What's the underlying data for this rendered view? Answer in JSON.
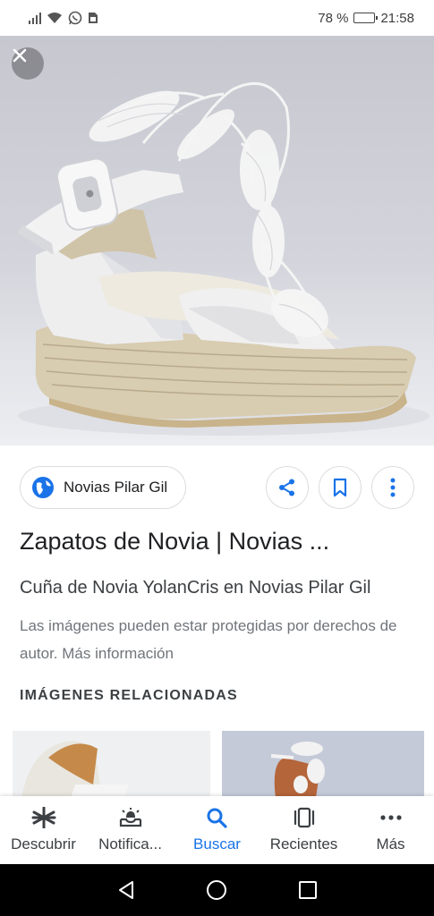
{
  "status_bar": {
    "battery_text": "78 %",
    "battery_level": 0.78,
    "time": "21:58",
    "icons": [
      "signal-icon",
      "wifi-icon",
      "whatsapp-icon",
      "sim-icon"
    ]
  },
  "hero": {
    "close_icon": "close-icon"
  },
  "source": {
    "label": "Novias Pilar Gil",
    "icon": "globe-icon"
  },
  "actions": {
    "share_icon": "share-icon",
    "bookmark_icon": "bookmark-icon",
    "more_icon": "more-vertical-icon"
  },
  "title": "Zapatos de Novia | Novias ...",
  "subtitle": "Cuña de Novia YolanCris en Novias Pilar Gil",
  "copyright_notice": "Las imágenes pueden estar protegidas por derechos de autor. Más información",
  "related_header": "IMÁGENES RELACIONADAS",
  "bottom_nav": {
    "items": [
      {
        "label": "Descubrir",
        "icon": "asterisk-icon",
        "active": false
      },
      {
        "label": "Notifica...",
        "icon": "bell-tray-icon",
        "active": false
      },
      {
        "label": "Buscar",
        "icon": "search-icon",
        "active": true
      },
      {
        "label": "Recientes",
        "icon": "recents-icon",
        "active": false
      },
      {
        "label": "Más",
        "icon": "more-horizontal-icon",
        "active": false
      }
    ]
  },
  "colors": {
    "accent": "#1a73e8",
    "text_primary": "#202124",
    "text_secondary": "#70757a"
  }
}
